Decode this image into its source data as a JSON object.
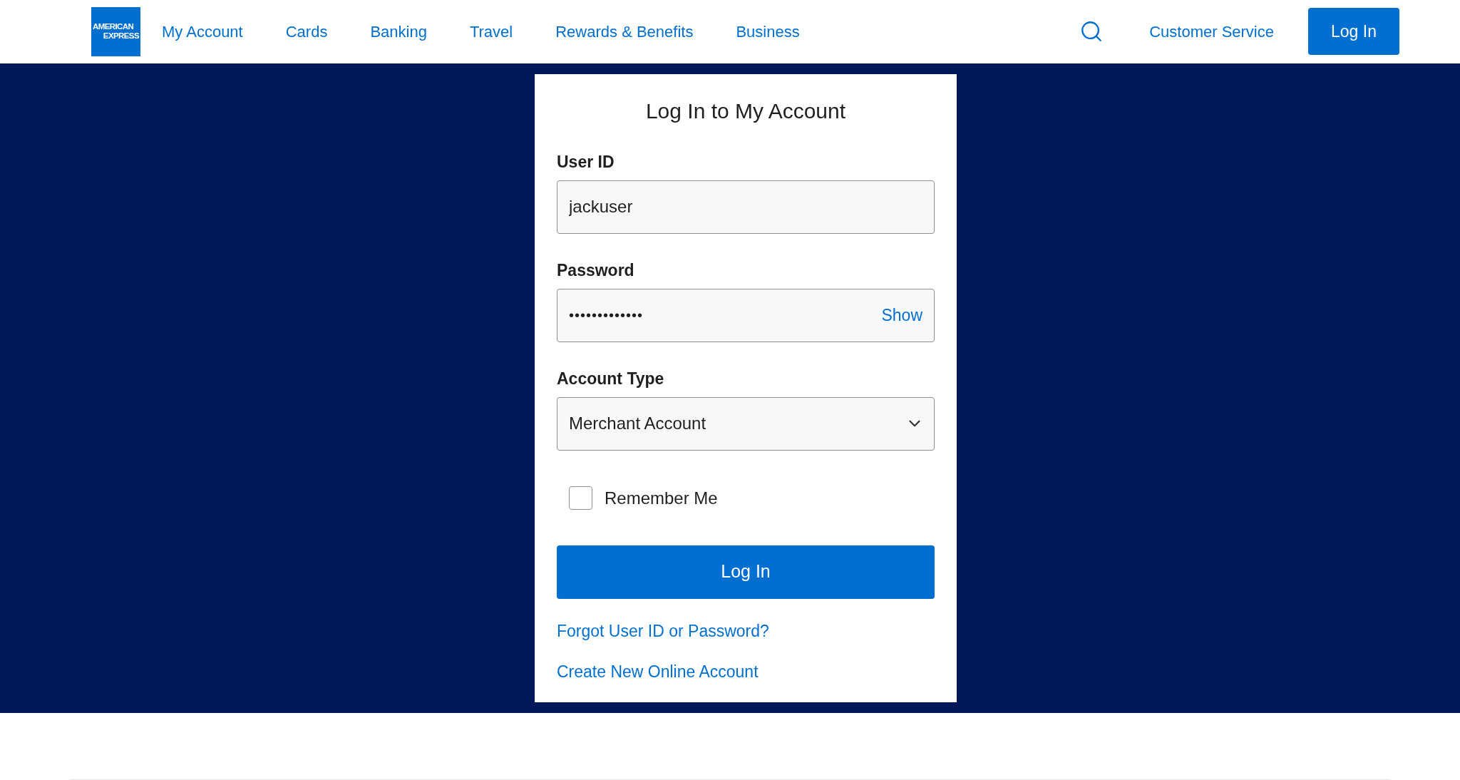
{
  "header": {
    "logo": {
      "lines": [
        "AMERICAN",
        "EXPRESS"
      ]
    },
    "nav": [
      "My Account",
      "Cards",
      "Banking",
      "Travel",
      "Rewards & Benefits",
      "Business"
    ],
    "customer_service": "Customer Service",
    "login_button": "Log In"
  },
  "login_card": {
    "title": "Log In to My Account",
    "fields": [
      {
        "kind": "text",
        "label": "User ID",
        "value": "jackuser"
      },
      {
        "kind": "password",
        "label": "Password",
        "value": "•••••••••••••",
        "toggle": "Show"
      },
      {
        "kind": "select",
        "label": "Account Type",
        "value": "Merchant Account"
      }
    ],
    "remember": {
      "label": "Remember Me",
      "checked": false
    },
    "submit": "Log In",
    "links": [
      "Forgot User ID or Password?",
      "Create New Online Account"
    ]
  }
}
